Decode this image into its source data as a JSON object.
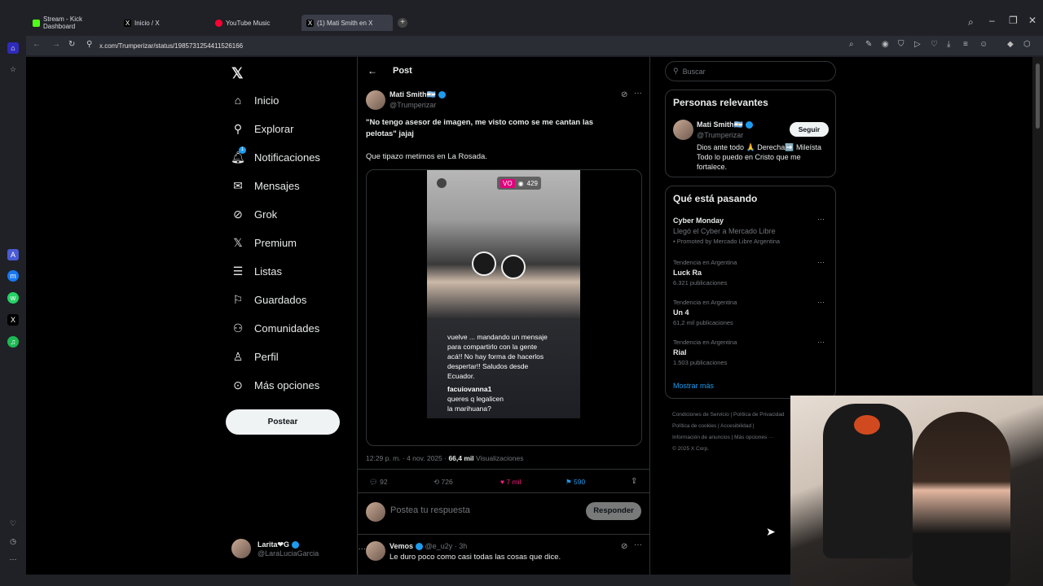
{
  "browser": {
    "tabs": [
      {
        "label": "Stream - Kick Dashboard"
      },
      {
        "label": "Inicio / X"
      },
      {
        "label": "YouTube Music"
      },
      {
        "label": "(1) Mati Smith en X"
      }
    ],
    "url": "x.com/Trumperizar/status/1985731254411526166"
  },
  "nav": {
    "items": [
      {
        "label": "Inicio",
        "icon": "home-icon"
      },
      {
        "label": "Explorar",
        "icon": "search-icon"
      },
      {
        "label": "Notificaciones",
        "icon": "bell-icon",
        "badge": "1"
      },
      {
        "label": "Mensajes",
        "icon": "mail-icon"
      },
      {
        "label": "Grok",
        "icon": "grok-icon"
      },
      {
        "label": "Premium",
        "icon": "x-icon"
      },
      {
        "label": "Listas",
        "icon": "list-icon"
      },
      {
        "label": "Guardados",
        "icon": "bookmark-icon"
      },
      {
        "label": "Comunidades",
        "icon": "people-icon"
      },
      {
        "label": "Perfil",
        "icon": "person-icon"
      },
      {
        "label": "Más opciones",
        "icon": "more-icon"
      }
    ],
    "post_button": "Postear",
    "account": {
      "name": "Larita❤G",
      "handle": "@LaraLuciaGarcia"
    }
  },
  "post": {
    "header": "Post",
    "author": {
      "name": "Mati Smith🇦🇷",
      "handle": "@Trumperizar"
    },
    "text1": "\"No tengo asesor de imagen, me visto como se me cantan las pelotas\" jajaj",
    "text2": "Que tipazo metimos en La Rosada.",
    "video": {
      "overlay_lines": [
        "vuelve ... mandando un mensaje",
        "para compartirlo con la gente",
        "acá!! No hay forma de hacerlos",
        "despertar!! Saludos desde",
        "Ecuador."
      ],
      "comment_user": "facuiovanna1",
      "comment_lines": [
        "queres q legalicen",
        "la marihuana?"
      ],
      "live_badge": "VO",
      "viewers": "429"
    },
    "time": "12:29 p. m. · 4 nov. 2025 ·",
    "views_count": "66,4 mil",
    "views_label": "Visualizaciones",
    "stats": {
      "replies": "92",
      "reposts": "726",
      "likes": "7 mil",
      "bookmarks": "590"
    },
    "reply_placeholder": "Postea tu respuesta",
    "reply_button": "Responder"
  },
  "reply": {
    "name": "Vemos",
    "handle": "@e_u2y · 3h",
    "text": "Le duro poco como casi todas las cosas que dice."
  },
  "sidebar": {
    "search_placeholder": "Buscar",
    "relevant_title": "Personas relevantes",
    "person": {
      "name": "Mati Smith🇦🇷",
      "handle": "@Trumperizar",
      "bio": "Dios ante todo 🙏 Derecha➡️ Mileísta Todo lo puedo en Cristo que me fortalece.",
      "follow": "Seguir"
    },
    "trending_title": "Qué está pasando",
    "trends": [
      {
        "top": "",
        "title": "Cyber Monday",
        "sub": "Llegó el Cyber a Mercado Libre",
        "extra": "Promoted by Mercado Libre Argentina"
      },
      {
        "top": "Tendencia en Argentina",
        "title": "Luck Ra",
        "sub": "6.321 publicaciones",
        "extra": ""
      },
      {
        "top": "Tendencia en Argentina",
        "title": "Un 4",
        "sub": "61,2 mil publicaciones",
        "extra": ""
      },
      {
        "top": "Tendencia en Argentina",
        "title": "Rial",
        "sub": "1.503 publicaciones",
        "extra": ""
      }
    ],
    "show_more": "Mostrar más",
    "footer": [
      "Condiciones de Servicio",
      "Política de Privacidad",
      "Política de cookies",
      "Accesibilidad",
      "Información de anuncios",
      "Más opciones ···",
      "© 2025 X Corp."
    ]
  },
  "colors": {
    "accent": "#1d9bf0",
    "like": "#f91880",
    "bg": "#000000"
  }
}
